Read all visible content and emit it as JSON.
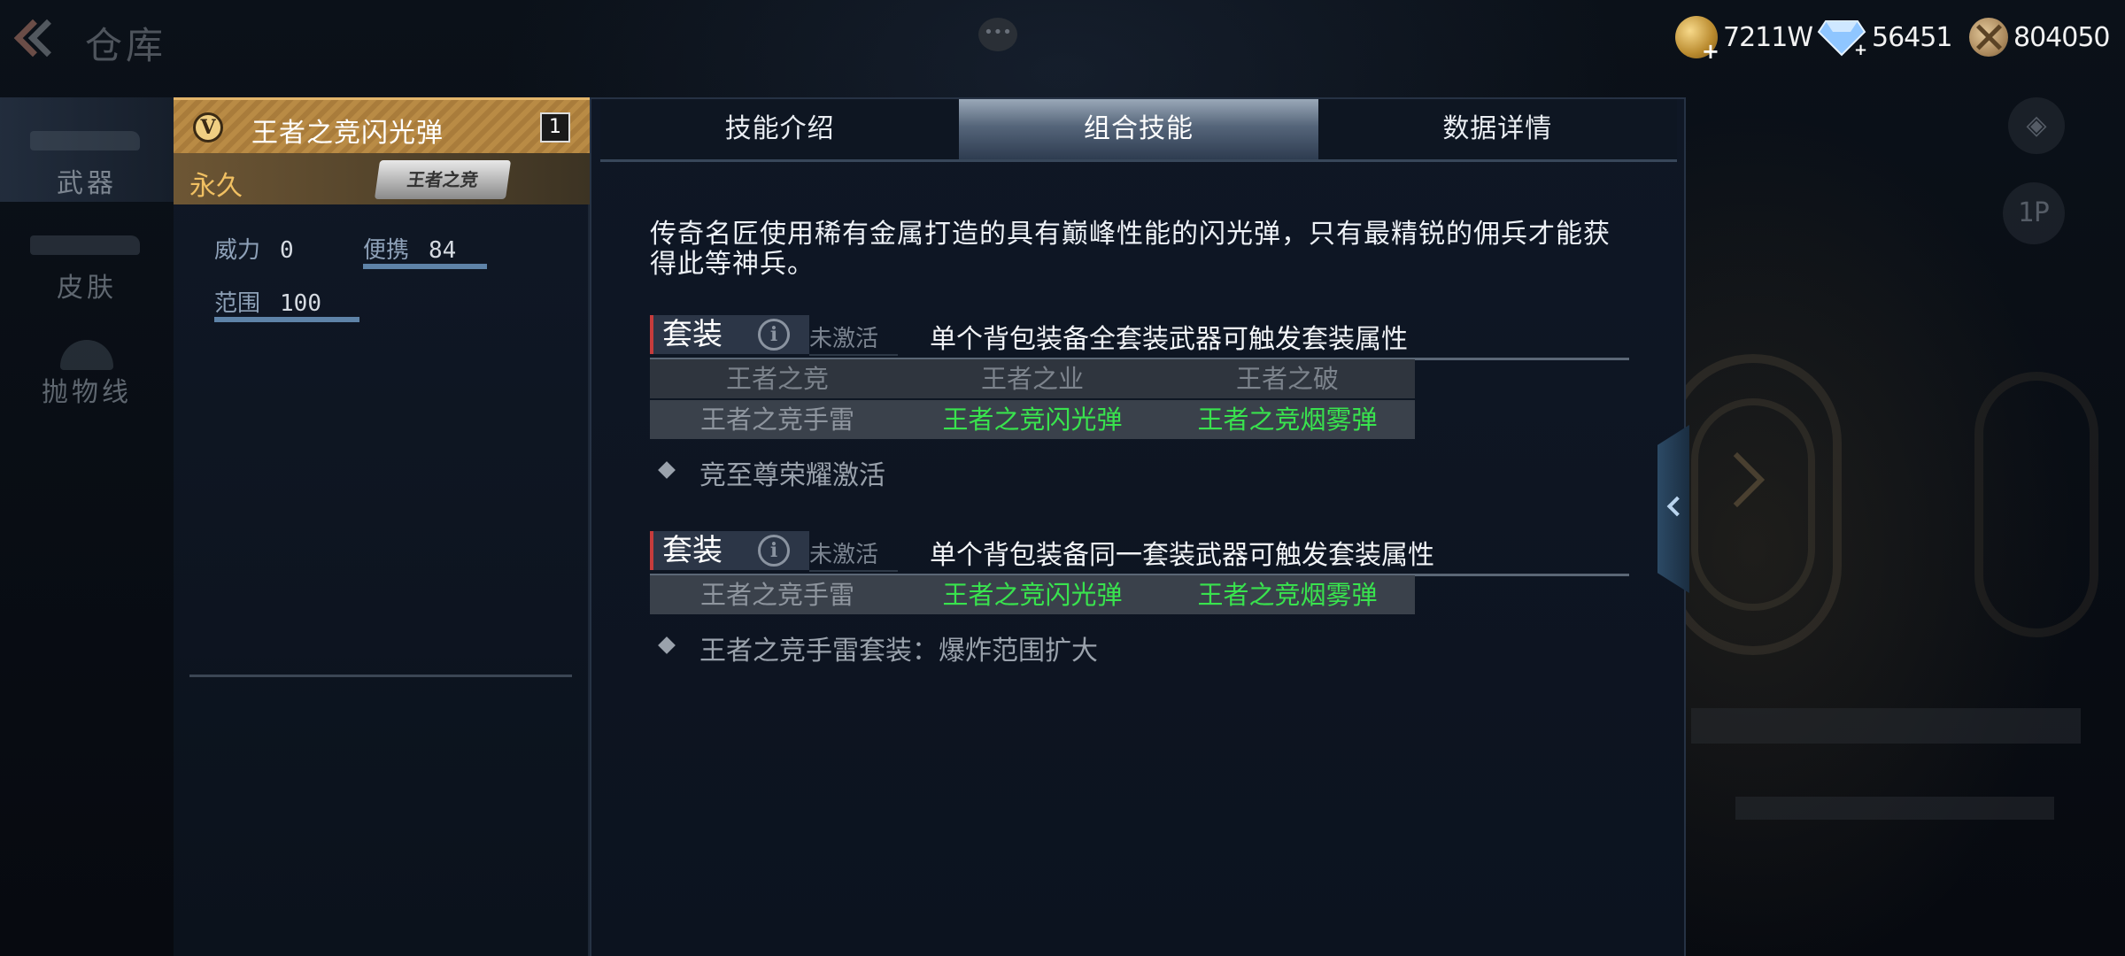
{
  "header": {
    "title": "仓库",
    "currencies": [
      {
        "icon": "gold-coin-icon",
        "value": "7211W"
      },
      {
        "icon": "diamond-icon",
        "value": "56451"
      },
      {
        "icon": "medal-coin-icon",
        "value": "804050"
      }
    ]
  },
  "categories": [
    {
      "label": "武器",
      "active": true
    },
    {
      "label": "皮肤",
      "active": false
    },
    {
      "label": "抛物线",
      "active": false
    }
  ],
  "item": {
    "badge": "V",
    "name": "王者之竞闪光弹",
    "count": "1",
    "duration": "永久",
    "logo_text": "王者之竞",
    "stats": [
      {
        "label": "威力",
        "value": "0",
        "fraction": 0
      },
      {
        "label": "便携",
        "value": "84",
        "fraction": 0.84
      },
      {
        "label": "范围",
        "value": "100",
        "fraction": 1.0
      }
    ]
  },
  "tabs": [
    {
      "label": "技能介绍",
      "active": false
    },
    {
      "label": "组合技能",
      "active": true
    },
    {
      "label": "数据详情",
      "active": false
    }
  ],
  "description": "传奇名匠使用稀有金属打造的具有巅峰性能的闪光弹，只有最精锐的佣兵才能获得此等神兵。",
  "sets": [
    {
      "tag": "套装",
      "status": "未激活",
      "condition": "单个背包装备全套装武器可触发套装属性",
      "header_row": [
        "王者之竞",
        "王者之业",
        "王者之破"
      ],
      "items_row": [
        {
          "text": "王者之竞手雷",
          "active": false
        },
        {
          "text": "王者之竞闪光弹",
          "active": true
        },
        {
          "text": "王者之竞烟雾弹",
          "active": true
        }
      ],
      "bonus": "竞至尊荣耀激活"
    },
    {
      "tag": "套装",
      "status": "未激活",
      "condition": "单个背包装备同一套装武器可触发套装属性",
      "items_row": [
        {
          "text": "王者之竞手雷",
          "active": false
        },
        {
          "text": "王者之竞闪光弹",
          "active": true
        },
        {
          "text": "王者之竞烟雾弹",
          "active": true
        }
      ],
      "bonus": "王者之竞手雷套装：爆炸范围扩大"
    }
  ],
  "side_buttons": [
    {
      "icon": "gamepad-icon",
      "label": ""
    },
    {
      "icon": "first-person-toggle-icon",
      "label": "1P"
    }
  ]
}
